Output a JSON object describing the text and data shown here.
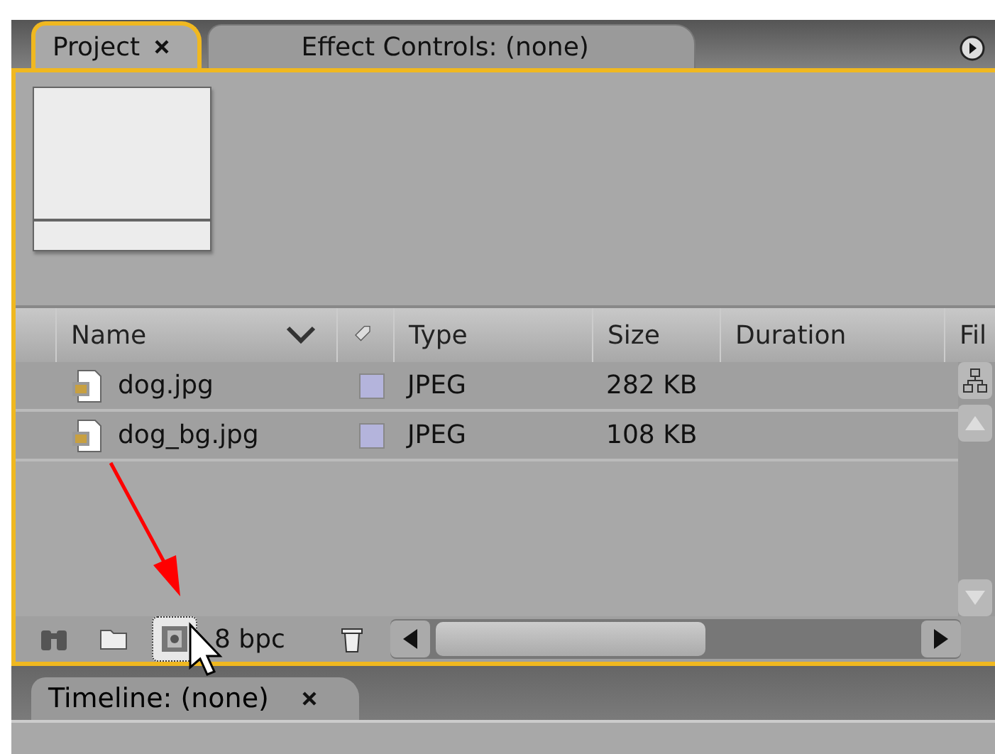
{
  "tabs": [
    {
      "label": "Project",
      "selected": true
    },
    {
      "label": "Effect Controls: (none)",
      "selected": false
    }
  ],
  "table": {
    "columns": [
      "Name",
      "Type",
      "Size",
      "Duration",
      "Fil"
    ],
    "rows": [
      {
        "name": "dog.jpg",
        "type": "JPEG",
        "size": "282 KB"
      },
      {
        "name": "dog_bg.jpg",
        "type": "JPEG",
        "size": "108 KB"
      }
    ]
  },
  "footer": {
    "bit_depth": "8 bpc"
  },
  "bottom_tab": {
    "label": "Timeline: (none)"
  }
}
